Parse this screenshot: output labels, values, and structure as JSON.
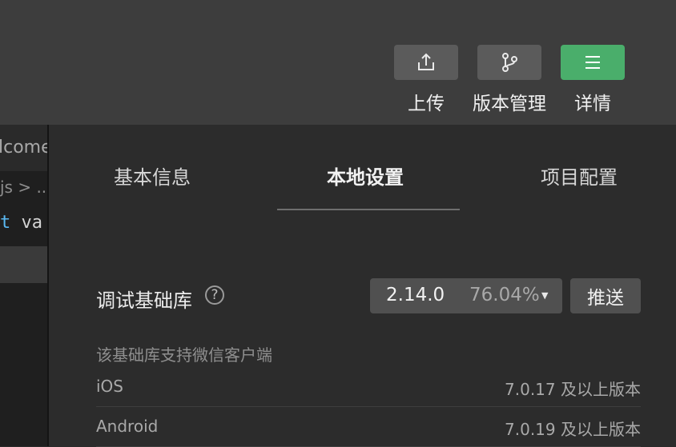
{
  "toolbar": {
    "upload_label": "上传",
    "version_label": "版本管理",
    "details_label": "详情"
  },
  "editor": {
    "tab_label": "lcome",
    "breadcrumb": "js > ..",
    "code_keyword": "t",
    "code_rest": " va"
  },
  "tabs": [
    {
      "label": "基本信息"
    },
    {
      "label": "本地设置"
    },
    {
      "label": "项目配置"
    }
  ],
  "debug_lib": {
    "label": "调试基础库",
    "help_symbol": "?",
    "version": "2.14.0",
    "percent": "76.04%",
    "caret": "▼",
    "push_label": "推送"
  },
  "support_heading": "该基础库支持微信客户端",
  "support_rows": [
    {
      "platform": "iOS",
      "requirement": "7.0.17 及以上版本"
    },
    {
      "platform": "Android",
      "requirement": "7.0.19 及以上版本"
    }
  ],
  "colors": {
    "accent_green": "#4aae6b",
    "toolbar_bg": "#3d3d3d",
    "panel_bg": "#2c2c2c"
  }
}
